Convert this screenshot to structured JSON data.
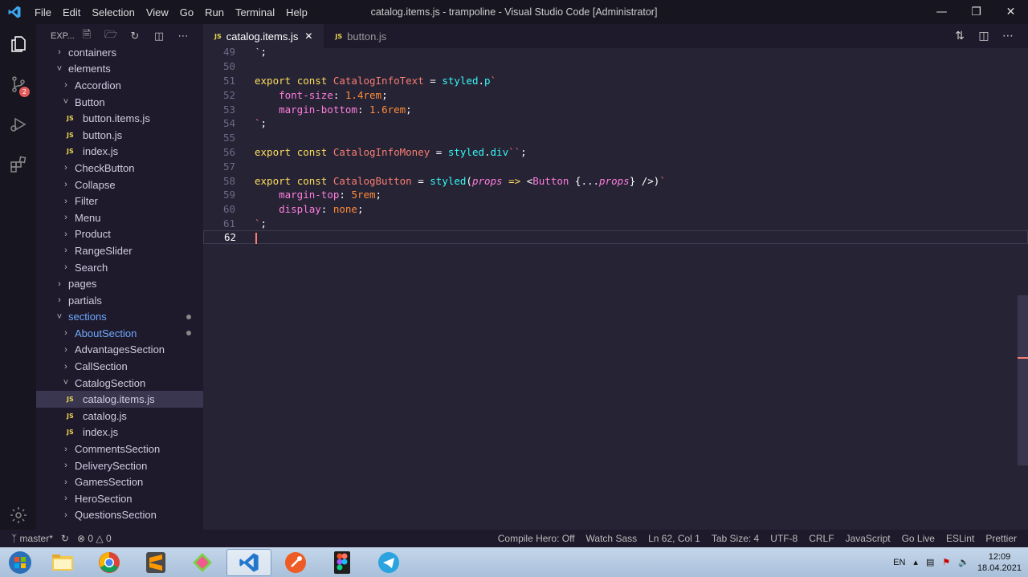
{
  "window": {
    "title": "catalog.items.js - trampoline - Visual Studio Code [Administrator]",
    "menu": [
      "File",
      "Edit",
      "Selection",
      "View",
      "Go",
      "Run",
      "Terminal",
      "Help"
    ]
  },
  "activity": {
    "scm_badge": "2"
  },
  "explorer": {
    "label": "EXP...",
    "tree": [
      {
        "label": "containers",
        "type": "folder",
        "open": false,
        "depth": 1
      },
      {
        "label": "elements",
        "type": "folder",
        "open": true,
        "depth": 1
      },
      {
        "label": "Accordion",
        "type": "folder",
        "open": false,
        "depth": 2
      },
      {
        "label": "Button",
        "type": "folder",
        "open": true,
        "depth": 2
      },
      {
        "label": "button.items.js",
        "type": "file",
        "depth": 3
      },
      {
        "label": "button.js",
        "type": "file",
        "depth": 3
      },
      {
        "label": "index.js",
        "type": "file",
        "depth": 3
      },
      {
        "label": "CheckButton",
        "type": "folder",
        "open": false,
        "depth": 2
      },
      {
        "label": "Collapse",
        "type": "folder",
        "open": false,
        "depth": 2
      },
      {
        "label": "Filter",
        "type": "folder",
        "open": false,
        "depth": 2
      },
      {
        "label": "Menu",
        "type": "folder",
        "open": false,
        "depth": 2
      },
      {
        "label": "Product",
        "type": "folder",
        "open": false,
        "depth": 2
      },
      {
        "label": "RangeSlider",
        "type": "folder",
        "open": false,
        "depth": 2
      },
      {
        "label": "Search",
        "type": "folder",
        "open": false,
        "depth": 2
      },
      {
        "label": "pages",
        "type": "folder",
        "open": false,
        "depth": 1
      },
      {
        "label": "partials",
        "type": "folder",
        "open": false,
        "depth": 1
      },
      {
        "label": "sections",
        "type": "folder",
        "open": true,
        "depth": 1,
        "modified": true
      },
      {
        "label": "AboutSection",
        "type": "folder",
        "open": false,
        "depth": 2,
        "modified": true
      },
      {
        "label": "AdvantagesSection",
        "type": "folder",
        "open": false,
        "depth": 2
      },
      {
        "label": "CallSection",
        "type": "folder",
        "open": false,
        "depth": 2
      },
      {
        "label": "CatalogSection",
        "type": "folder",
        "open": true,
        "depth": 2
      },
      {
        "label": "catalog.items.js",
        "type": "file",
        "depth": 3,
        "selected": true
      },
      {
        "label": "catalog.js",
        "type": "file",
        "depth": 3
      },
      {
        "label": "index.js",
        "type": "file",
        "depth": 3
      },
      {
        "label": "CommentsSection",
        "type": "folder",
        "open": false,
        "depth": 2
      },
      {
        "label": "DeliverySection",
        "type": "folder",
        "open": false,
        "depth": 2
      },
      {
        "label": "GamesSection",
        "type": "folder",
        "open": false,
        "depth": 2
      },
      {
        "label": "HeroSection",
        "type": "folder",
        "open": false,
        "depth": 2
      },
      {
        "label": "QuestionsSection",
        "type": "folder",
        "open": false,
        "depth": 2
      }
    ]
  },
  "tabs": [
    {
      "label": "catalog.items.js",
      "active": true
    },
    {
      "label": "button.js",
      "active": false
    }
  ],
  "editor": {
    "current_line": 62,
    "lines": [
      {
        "n": "49",
        "tokens": [
          [
            "pl",
            "`;"
          ]
        ]
      },
      {
        "n": "50",
        "tokens": []
      },
      {
        "n": "51",
        "tokens": [
          [
            "kw",
            "export "
          ],
          [
            "kw",
            "const "
          ],
          [
            "nm",
            "CatalogInfoText"
          ],
          [
            "pl",
            " = "
          ],
          [
            "fn",
            "styled"
          ],
          [
            "pl",
            "."
          ],
          [
            "fn",
            "p"
          ],
          [
            "bt",
            "`"
          ]
        ]
      },
      {
        "n": "52",
        "tokens": [
          [
            "pl",
            "    "
          ],
          [
            "pr",
            "font-size"
          ],
          [
            "pl",
            ": "
          ],
          [
            "str",
            "1.4rem"
          ],
          [
            "pl",
            ";"
          ]
        ]
      },
      {
        "n": "53",
        "tokens": [
          [
            "pl",
            "    "
          ],
          [
            "pr",
            "margin-bottom"
          ],
          [
            "pl",
            ": "
          ],
          [
            "str",
            "1.6rem"
          ],
          [
            "pl",
            ";"
          ]
        ]
      },
      {
        "n": "54",
        "tokens": [
          [
            "bt",
            "`"
          ],
          [
            "pl",
            ";"
          ]
        ]
      },
      {
        "n": "55",
        "tokens": []
      },
      {
        "n": "56",
        "tokens": [
          [
            "kw",
            "export "
          ],
          [
            "kw",
            "const "
          ],
          [
            "nm",
            "CatalogInfoMoney"
          ],
          [
            "pl",
            " = "
          ],
          [
            "fn",
            "styled"
          ],
          [
            "pl",
            "."
          ],
          [
            "fn",
            "div"
          ],
          [
            "bt",
            "``"
          ],
          [
            "pl",
            ";"
          ]
        ]
      },
      {
        "n": "57",
        "tokens": []
      },
      {
        "n": "58",
        "tokens": [
          [
            "kw",
            "export "
          ],
          [
            "kw",
            "const "
          ],
          [
            "nm",
            "CatalogButton"
          ],
          [
            "pl",
            " = "
          ],
          [
            "fn",
            "styled"
          ],
          [
            "pl",
            "("
          ],
          [
            "it",
            "props"
          ],
          [
            "pl",
            " "
          ],
          [
            "kw",
            "=>"
          ],
          [
            "pl",
            " <"
          ],
          [
            "tag",
            "Button"
          ],
          [
            "pl",
            " {..."
          ],
          [
            "it",
            "props"
          ],
          [
            "pl",
            "} />)"
          ],
          [
            "bt",
            "`"
          ]
        ]
      },
      {
        "n": "59",
        "tokens": [
          [
            "pl",
            "    "
          ],
          [
            "pr",
            "margin-top"
          ],
          [
            "pl",
            ": "
          ],
          [
            "str",
            "5rem"
          ],
          [
            "pl",
            ";"
          ]
        ]
      },
      {
        "n": "60",
        "tokens": [
          [
            "pl",
            "    "
          ],
          [
            "pr",
            "display"
          ],
          [
            "pl",
            ": "
          ],
          [
            "str",
            "none"
          ],
          [
            "pl",
            ";"
          ]
        ]
      },
      {
        "n": "61",
        "tokens": [
          [
            "bt",
            "`"
          ],
          [
            "pl",
            ";"
          ]
        ]
      },
      {
        "n": "62",
        "tokens": []
      }
    ]
  },
  "statusbar": {
    "branch": "master*",
    "problems": "0",
    "warnings": "0",
    "items": [
      "Compile Hero: Off",
      "Watch Sass",
      "Ln 62, Col 1",
      "Tab Size: 4",
      "UTF-8",
      "CRLF",
      "JavaScript",
      "Go Live",
      "ESLint",
      "Prettier"
    ]
  },
  "taskbar": {
    "lang": "EN",
    "time": "12:09",
    "date": "18.04.2021",
    "apps": [
      "file-explorer",
      "chrome",
      "sublime-text",
      "git-kraken",
      "vscode",
      "postman",
      "figma",
      "telegram"
    ]
  }
}
